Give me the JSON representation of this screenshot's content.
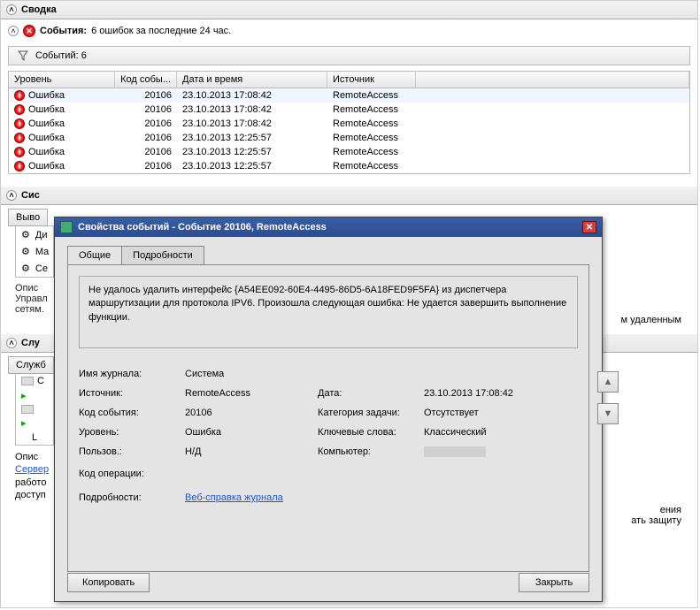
{
  "summary": {
    "title": "Сводка"
  },
  "events_header": {
    "label": "События:",
    "summary": "6 ошибок за последние 24 час."
  },
  "filter": {
    "label": "Событий: 6"
  },
  "columns": {
    "level": "Уровень",
    "code": "Код собы...",
    "date": "Дата и время",
    "source": "Источник"
  },
  "rows": [
    {
      "level": "Ошибка",
      "code": "20106",
      "date": "23.10.2013 17:08:42",
      "source": "RemoteAccess"
    },
    {
      "level": "Ошибка",
      "code": "20106",
      "date": "23.10.2013 17:08:42",
      "source": "RemoteAccess"
    },
    {
      "level": "Ошибка",
      "code": "20106",
      "date": "23.10.2013 17:08:42",
      "source": "RemoteAccess"
    },
    {
      "level": "Ошибка",
      "code": "20106",
      "date": "23.10.2013 12:25:57",
      "source": "RemoteAccess"
    },
    {
      "level": "Ошибка",
      "code": "20106",
      "date": "23.10.2013 12:25:57",
      "source": "RemoteAccess"
    },
    {
      "level": "Ошибка",
      "code": "20106",
      "date": "23.10.2013 12:25:57",
      "source": "RemoteAccess"
    }
  ],
  "sis": {
    "header": "Сис",
    "btn_label": "Выво",
    "items": {
      "di": "Ди",
      "ma": "Ма",
      "se": "Се"
    },
    "desc1": "Опис",
    "desc2": "Управл",
    "desc3": "сетям.",
    "trail1": "м удаленным"
  },
  "serv": {
    "header": "Слу",
    "btn_label": "Служб",
    "item_c": "С",
    "item_l": "L",
    "desc": "Опис",
    "f1": "Сервер",
    "f2": "работо",
    "f3": "доступ",
    "trail1": "ения",
    "trail2": "ать защиту"
  },
  "dialog": {
    "title": "Свойства событий - Событие 20106, RemoteAccess",
    "tabs": {
      "general": "Общие",
      "details": "Подробности"
    },
    "message": "Не удалось удалить интерфейс {A54EE092-60E4-4495-86D5-6A18FED9F5FA} из диспетчера маршрутизации для протокола IPV6. Произошла следующая ошибка: Не удается завершить выполнение функции.",
    "labels": {
      "log": "Имя журнала:",
      "source": "Источник:",
      "eventid": "Код события:",
      "level": "Уровень:",
      "user": "Пользов.:",
      "opcode": "Код операции:",
      "details": "Подробности:",
      "date": "Дата:",
      "taskcat": "Категория задачи:",
      "keywords": "Ключевые слова:",
      "computer": "Компьютер:"
    },
    "values": {
      "log": "Система",
      "source": "RemoteAccess",
      "eventid": "20106",
      "level": "Ошибка",
      "user": "Н/Д",
      "opcode": "",
      "date": "23.10.2013 17:08:42",
      "taskcat": "Отсутствует",
      "keywords": "Классический",
      "computer": ""
    },
    "help_link": "Веб-справка журнала",
    "copy": "Копировать",
    "close": "Закрыть"
  }
}
